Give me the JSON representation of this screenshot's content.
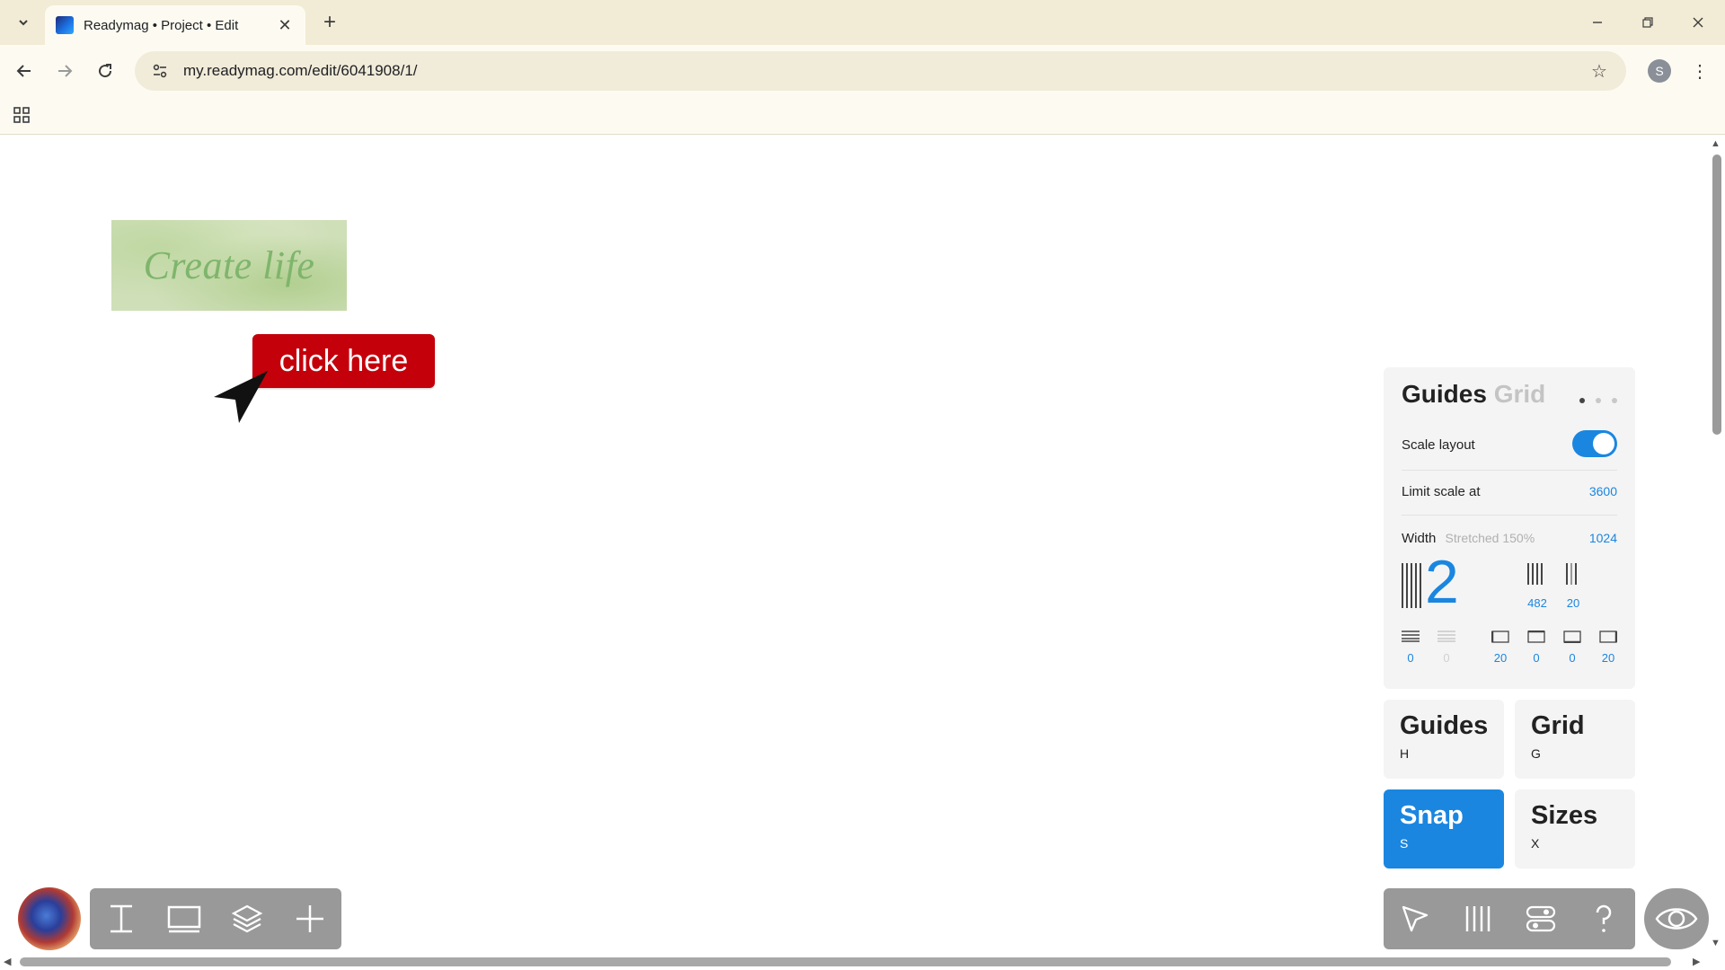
{
  "browser": {
    "tab_title": "Readymag • Project • Edit",
    "url": "my.readymag.com/edit/6041908/1/",
    "profile_initial": "S"
  },
  "canvas": {
    "hero_text": "Create life",
    "cta_label": "click here"
  },
  "panel": {
    "title_active": "Guides",
    "title_inactive": "Grid",
    "scale_layout_label": "Scale layout",
    "scale_layout_on": true,
    "limit_scale_label": "Limit scale at",
    "limit_scale_value": "3600",
    "width_label": "Width",
    "width_hint": "Stretched 150%",
    "width_value": "1024",
    "columns_count": "2",
    "column_width": "482",
    "gutter": "20",
    "rows_value": "0",
    "row_gap_value": "0",
    "margin_left": "20",
    "margin_top": "0",
    "margin_bottom": "0",
    "margin_right": "20"
  },
  "tiles": [
    {
      "title": "Guides",
      "key": "H",
      "active": false
    },
    {
      "title": "Grid",
      "key": "G",
      "active": false
    },
    {
      "title": "Snap",
      "key": "S",
      "active": true
    },
    {
      "title": "Sizes",
      "key": "X",
      "active": false
    }
  ],
  "colors": {
    "accent": "#1a86e0",
    "cta": "#c4000b",
    "dock": "#999999"
  }
}
